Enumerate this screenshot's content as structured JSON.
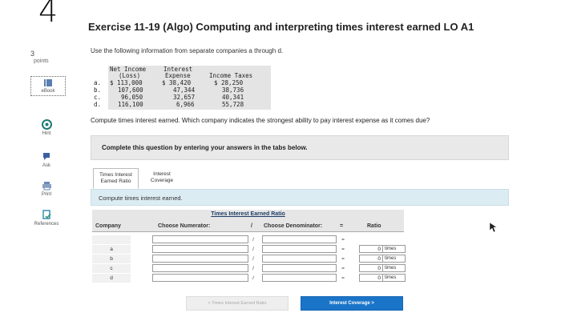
{
  "question": {
    "number": "4",
    "title": "Exercise 11-19 (Algo) Computing and interpreting times interest earned LO A1",
    "points_value": "3",
    "points_label": "points",
    "intro": "Use the following information from separate companies a through d.",
    "prompt": "Compute times interest earned. Which company indicates the strongest ability to pay interest expense as it comes due?"
  },
  "sidebar": {
    "ebook": "eBook",
    "hint": "Hint",
    "ask": "Ask",
    "print": "Print",
    "references": "References"
  },
  "given_table": {
    "headers": {
      "net_income_1": "Net Income",
      "net_income_2": "(Loss)",
      "interest_1": "Interest",
      "interest_2": "Expense",
      "taxes": "Income Taxes"
    },
    "rows": [
      {
        "label": "a.",
        "net_income": "$ 113,000",
        "interest": "$ 38,420",
        "taxes": "$ 28,250"
      },
      {
        "label": "b.",
        "net_income": "107,600",
        "interest": "47,344",
        "taxes": "38,736"
      },
      {
        "label": "c.",
        "net_income": "96,050",
        "interest": "32,657",
        "taxes": "40,341"
      },
      {
        "label": "d.",
        "net_income": "116,100",
        "interest": "6,966",
        "taxes": "55,728"
      }
    ]
  },
  "instructions": "Complete this question by entering your answers in the tabs below.",
  "tabs": [
    {
      "line1": "Times Interest",
      "line2": "Earned Ratio"
    },
    {
      "line1": "Interest",
      "line2": "Coverage"
    }
  ],
  "compute_label": "Compute times interest earned.",
  "answer_grid": {
    "title": "Times Interest Earned Ratio",
    "headers": {
      "company": "Company",
      "numerator": "Choose Numerator:",
      "slash": "/",
      "denominator": "Choose Denominator:",
      "equals": "=",
      "ratio": "Ratio"
    },
    "rows": [
      {
        "company": "a",
        "slash": "/",
        "equals": "=",
        "ratio": "0",
        "unit": "times"
      },
      {
        "company": "b",
        "slash": "/",
        "equals": "=",
        "ratio": "0",
        "unit": "times"
      },
      {
        "company": "c",
        "slash": "/",
        "equals": "=",
        "ratio": "0",
        "unit": "times"
      },
      {
        "company": "d",
        "slash": "/",
        "equals": "=",
        "ratio": "0",
        "unit": "times"
      }
    ]
  },
  "nav": {
    "prev": "Times Interest Earned Ratio",
    "next": "Interest Coverage",
    "prev_arrow": "<",
    "next_arrow": ">"
  }
}
